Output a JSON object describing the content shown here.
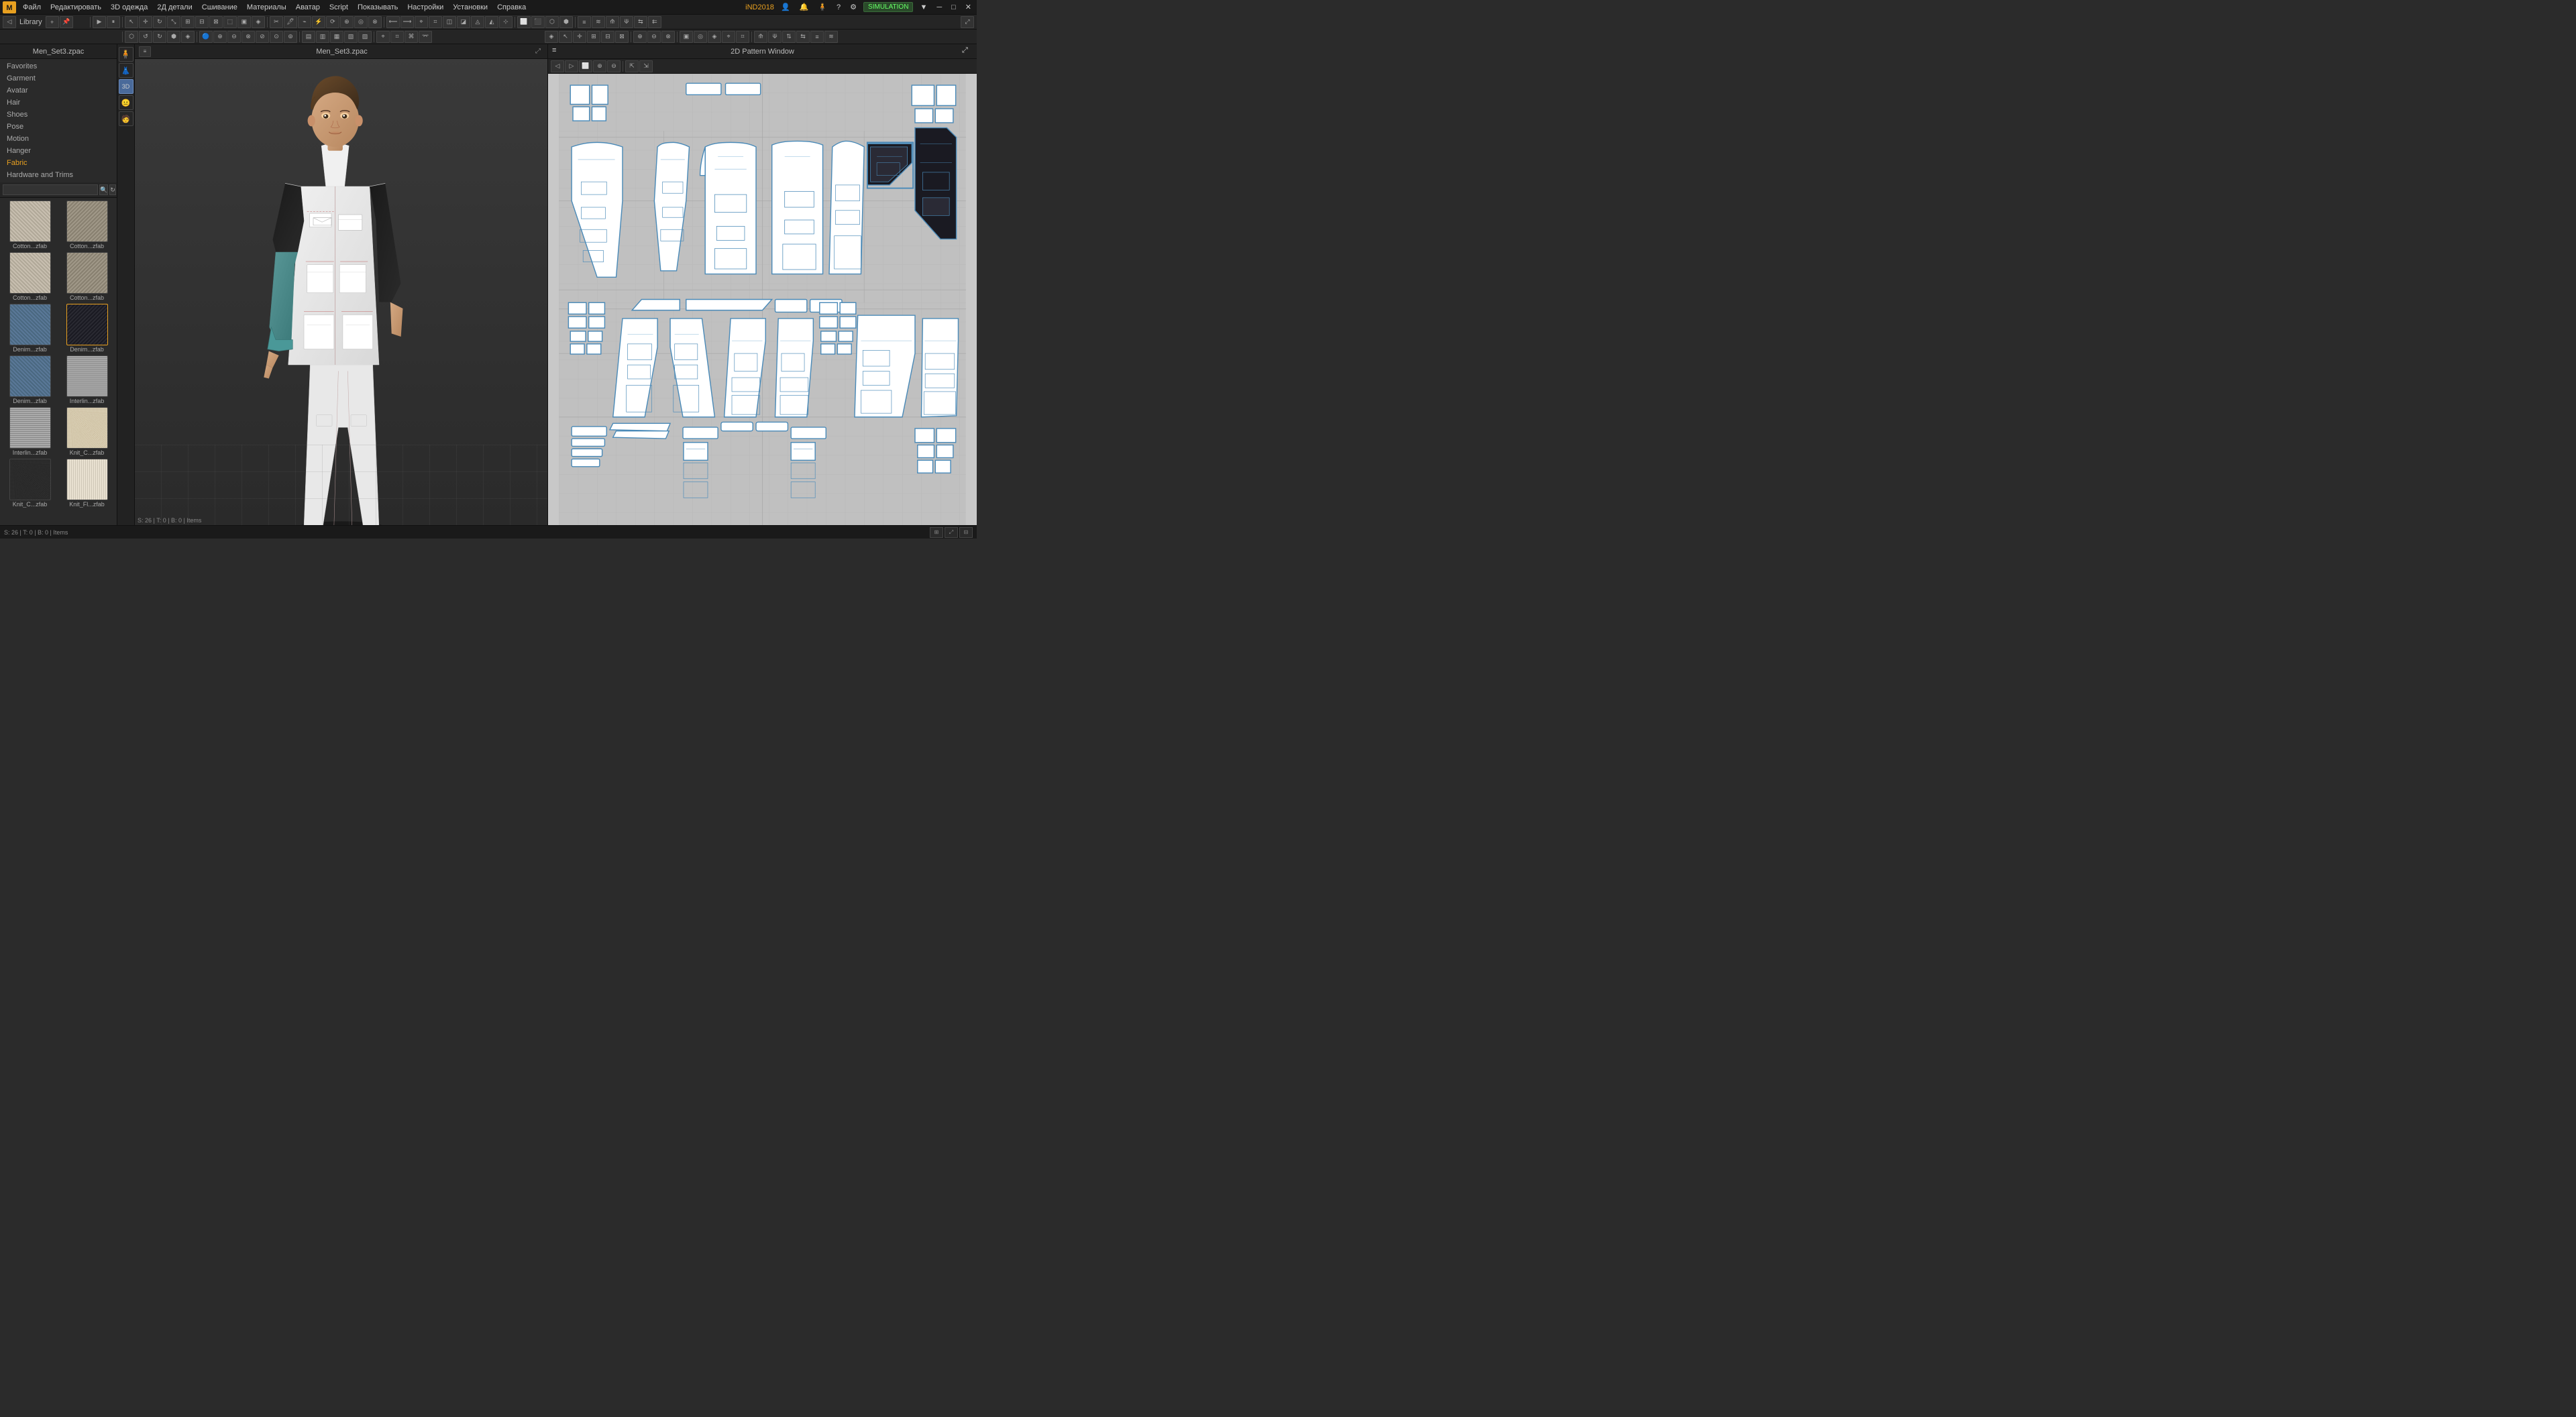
{
  "app": {
    "title": "Marvelous Designer",
    "version": "iND2018"
  },
  "menu": {
    "items": [
      "Файл",
      "Редактировать",
      "3D одежда",
      "2Д детали",
      "Сшивание",
      "Материалы",
      "Аватар",
      "Script",
      "Показывать",
      "Настройки",
      "Установки",
      "Справка"
    ],
    "right": {
      "version": "iND2018",
      "simulation": "SIMULATION"
    }
  },
  "library": {
    "title": "Library",
    "header": "Men_Set3.zpac",
    "tabs": [
      "Favorites",
      "Garment",
      "Avatar",
      "Hair",
      "Shoes",
      "Pose",
      "Motion",
      "Hanger",
      "Fabric",
      "Hardware and Trims"
    ]
  },
  "search": {
    "placeholder": ""
  },
  "fabrics": [
    {
      "label": "Cotton...zfab",
      "type": "cotton-light"
    },
    {
      "label": "Cotton...zfab",
      "type": "cotton-dark"
    },
    {
      "label": "Cotton...zfab",
      "type": "cotton-light"
    },
    {
      "label": "Cotton...zfab",
      "type": "cotton-dark"
    },
    {
      "label": "Denim...zfab",
      "type": "denim-light"
    },
    {
      "label": "Denim...zfab",
      "type": "denim-dark",
      "selected": true
    },
    {
      "label": "Denim...zfab",
      "type": "denim-light"
    },
    {
      "label": "Interlin...zfab",
      "type": "interlin"
    },
    {
      "label": "Interlin...zfab",
      "type": "interlin"
    },
    {
      "label": "Knit_C...zfab",
      "type": "knit-cream"
    },
    {
      "label": "Knit_C...zfab",
      "type": "knit-dark"
    },
    {
      "label": "Knit_Fl...zfab",
      "type": "knit-fl"
    }
  ],
  "viewport": {
    "title": "Men_Set3.zpac",
    "status": "S: 26 | T: 0 | B: 0 | Items"
  },
  "pattern": {
    "title": "2D Pattern Window"
  },
  "bottom": {
    "info": ""
  }
}
